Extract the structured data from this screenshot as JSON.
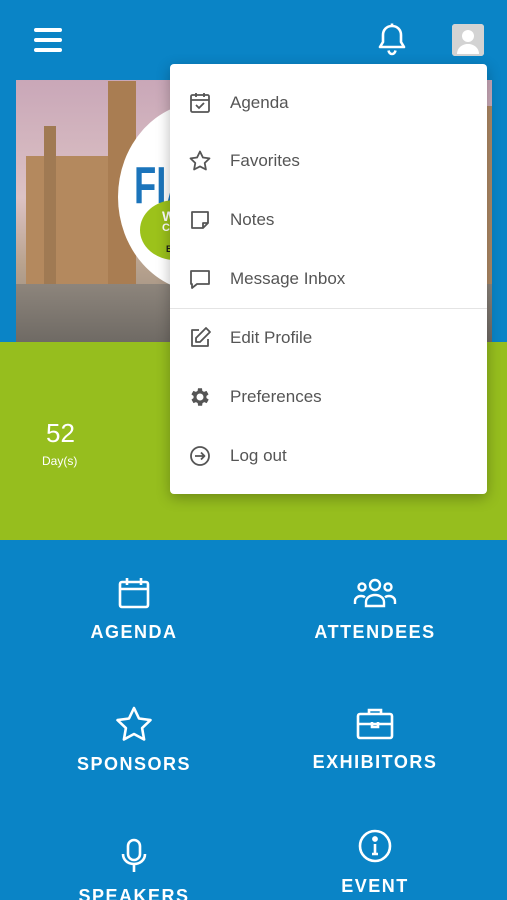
{
  "header": {
    "menu_icon": "hamburger-icon",
    "bell_icon": "bell-icon",
    "avatar_icon": "user-avatar-icon"
  },
  "hero": {
    "logo_main": "FIA",
    "logo_sub1": "WO",
    "logo_sub2": "CON",
    "logo_city": "BRU"
  },
  "countdown": {
    "value": "52",
    "unit": "Day(s)"
  },
  "dropdown": {
    "items": [
      {
        "label": "Agenda",
        "icon": "calendar-check-icon"
      },
      {
        "label": "Favorites",
        "icon": "star-icon"
      },
      {
        "label": "Notes",
        "icon": "note-icon"
      },
      {
        "label": "Message Inbox",
        "icon": "message-icon"
      },
      {
        "label": "Edit Profile",
        "icon": "edit-icon"
      },
      {
        "label": "Preferences",
        "icon": "gear-icon"
      },
      {
        "label": "Log out",
        "icon": "logout-icon"
      }
    ]
  },
  "tiles": [
    {
      "label": "AGENDA",
      "icon": "calendar-icon"
    },
    {
      "label": "ATTENDEES",
      "icon": "people-icon"
    },
    {
      "label": "SPONSORS",
      "icon": "star-icon"
    },
    {
      "label": "EXHIBITORS",
      "icon": "briefcase-icon"
    },
    {
      "label": "SPEAKERS",
      "icon": "microphone-icon"
    },
    {
      "label": "EVENT",
      "icon": "info-icon"
    }
  ],
  "colors": {
    "primary_blue": "#0a84c6",
    "accent_green": "#96be1e"
  }
}
